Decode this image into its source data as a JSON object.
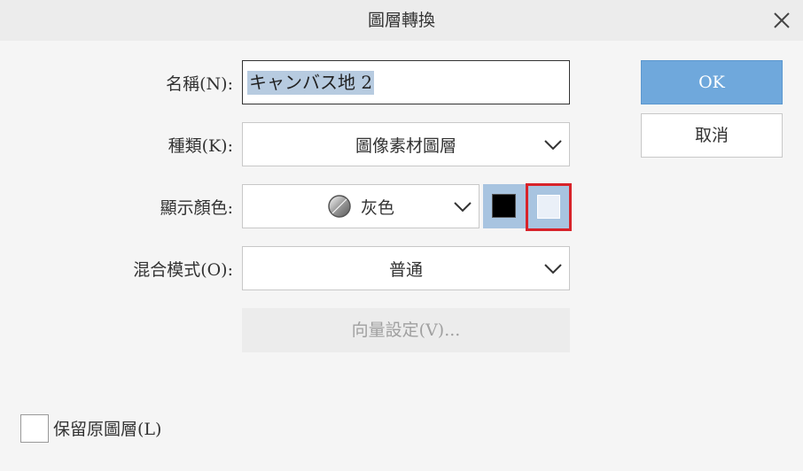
{
  "dialog": {
    "title": "圖層轉換"
  },
  "form": {
    "name_label": "名稱(N):",
    "name_value": "キャンバス地 2",
    "kind_label": "種類(K):",
    "kind_value": "圖像素材圖層",
    "display_color_label": "顯示顏色:",
    "display_color_value": "灰色",
    "blend_mode_label": "混合模式(O):",
    "blend_mode_value": "普通",
    "vector_settings_label": "向量設定(V)..."
  },
  "buttons": {
    "ok": "OK",
    "cancel": "取消"
  },
  "checkbox": {
    "label": "保留原圖層(L)",
    "checked": false
  },
  "colors": {
    "ok_button": "#6fa8dc",
    "swatch_group_bg": "#a8c4e0",
    "swatch_black": "#000000",
    "swatch_white": "#eaf0f8",
    "highlight_frame": "#d8232a"
  },
  "icons": {
    "close": "close-icon",
    "chevron": "chevron-down-icon",
    "gray_color": "gray-color-icon"
  }
}
